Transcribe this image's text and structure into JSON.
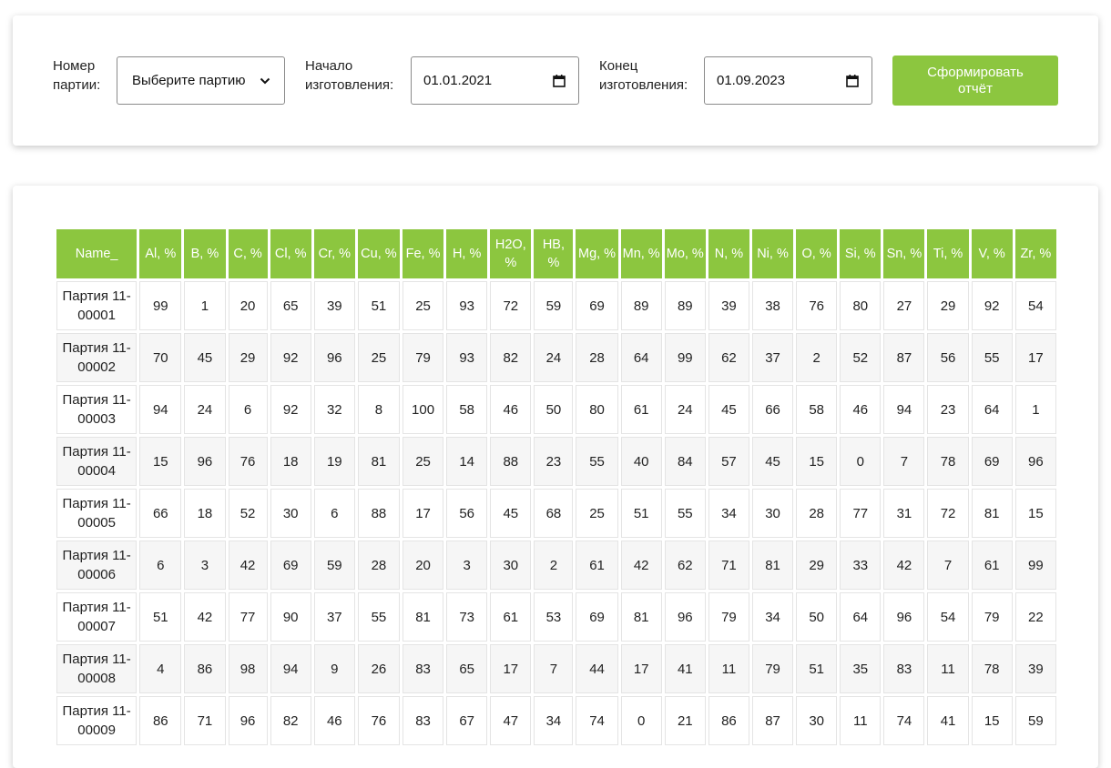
{
  "filters": {
    "batch_label": "Номер партии:",
    "batch_value": "Выберите партию",
    "start_label": "Начало изготовления:",
    "start_value": "01.01.2021",
    "end_label": "Конец изготовления:",
    "end_value": "01.09.2023",
    "submit_label": "Сформировать отчёт"
  },
  "table": {
    "columns": [
      "Name_",
      "Al, %",
      "B, %",
      "C, %",
      "Cl, %",
      "Cr, %",
      "Cu, %",
      "Fe, %",
      "H, %",
      "H2O, %",
      "HB, %",
      "Mg, %",
      "Mn, %",
      "Mo, %",
      "N, %",
      "Ni, %",
      "O, %",
      "Si, %",
      "Sn, %",
      "Ti, %",
      "V, %",
      "Zr, %"
    ],
    "rows": [
      [
        "Партия 11-00001",
        "99",
        "1",
        "20",
        "65",
        "39",
        "51",
        "25",
        "93",
        "72",
        "59",
        "69",
        "89",
        "89",
        "39",
        "38",
        "76",
        "80",
        "27",
        "29",
        "92",
        "54"
      ],
      [
        "Партия 11-00002",
        "70",
        "45",
        "29",
        "92",
        "96",
        "25",
        "79",
        "93",
        "82",
        "24",
        "28",
        "64",
        "99",
        "62",
        "37",
        "2",
        "52",
        "87",
        "56",
        "55",
        "17"
      ],
      [
        "Партия 11-00003",
        "94",
        "24",
        "6",
        "92",
        "32",
        "8",
        "100",
        "58",
        "46",
        "50",
        "80",
        "61",
        "24",
        "45",
        "66",
        "58",
        "46",
        "94",
        "23",
        "64",
        "1"
      ],
      [
        "Партия 11-00004",
        "15",
        "96",
        "76",
        "18",
        "19",
        "81",
        "25",
        "14",
        "88",
        "23",
        "55",
        "40",
        "84",
        "57",
        "45",
        "15",
        "0",
        "7",
        "78",
        "69",
        "96"
      ],
      [
        "Партия 11-00005",
        "66",
        "18",
        "52",
        "30",
        "6",
        "88",
        "17",
        "56",
        "45",
        "68",
        "25",
        "51",
        "55",
        "34",
        "30",
        "28",
        "77",
        "31",
        "72",
        "81",
        "15"
      ],
      [
        "Партия 11-00006",
        "6",
        "3",
        "42",
        "69",
        "59",
        "28",
        "20",
        "3",
        "30",
        "2",
        "61",
        "42",
        "62",
        "71",
        "81",
        "29",
        "33",
        "42",
        "7",
        "61",
        "99"
      ],
      [
        "Партия 11-00007",
        "51",
        "42",
        "77",
        "90",
        "37",
        "55",
        "81",
        "73",
        "61",
        "53",
        "69",
        "81",
        "96",
        "79",
        "34",
        "50",
        "64",
        "96",
        "54",
        "79",
        "22"
      ],
      [
        "Партия 11-00008",
        "4",
        "86",
        "98",
        "94",
        "9",
        "26",
        "83",
        "65",
        "17",
        "7",
        "44",
        "17",
        "41",
        "11",
        "79",
        "51",
        "35",
        "83",
        "11",
        "78",
        "39"
      ],
      [
        "Партия 11-00009",
        "86",
        "71",
        "96",
        "82",
        "46",
        "76",
        "83",
        "67",
        "47",
        "34",
        "74",
        "0",
        "21",
        "86",
        "87",
        "30",
        "11",
        "74",
        "41",
        "15",
        "59"
      ]
    ]
  }
}
